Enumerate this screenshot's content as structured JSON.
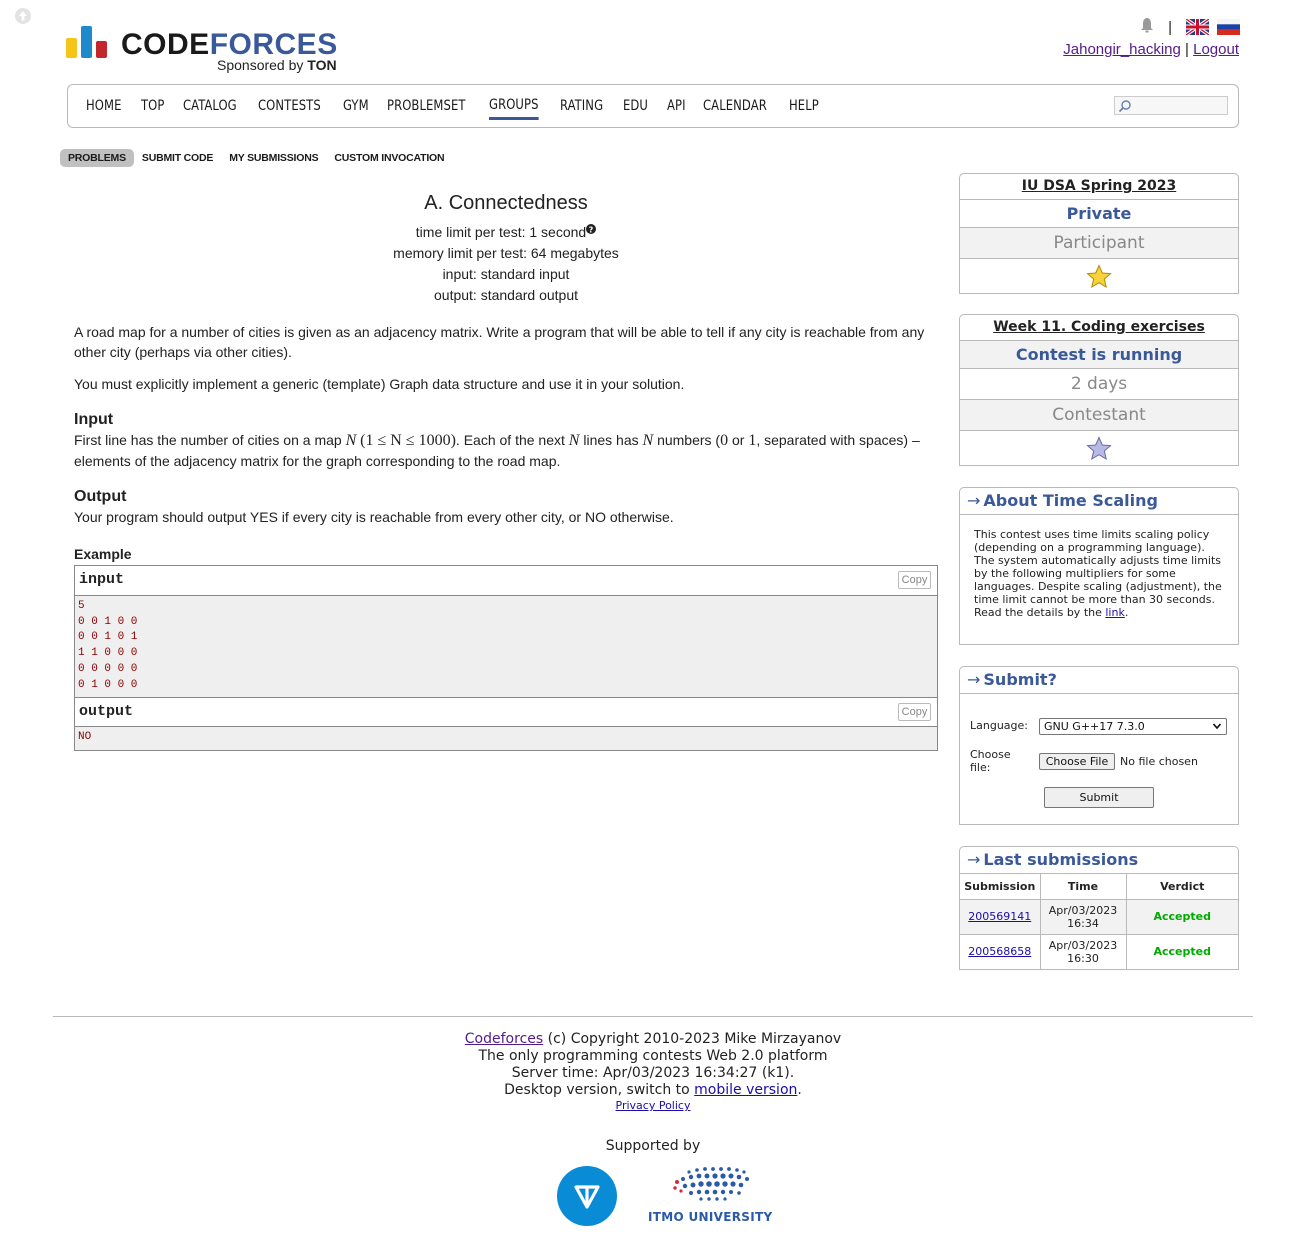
{
  "header": {
    "logo_text_a": "CODE",
    "logo_text_b": "FORCES",
    "logo_sponsor": "Sponsored by",
    "logo_sponsor_brand": "TON",
    "username": "Jahongir_hacking",
    "separator": "|",
    "logout": "Logout"
  },
  "menu": {
    "items": [
      "HOME",
      "TOP",
      "CATALOG",
      "CONTESTS",
      "GYM",
      "PROBLEMSET",
      "GROUPS",
      "RATING",
      "EDU",
      "API",
      "CALENDAR",
      "HELP"
    ],
    "active": "GROUPS"
  },
  "subnav": {
    "items": [
      "PROBLEMS",
      "SUBMIT CODE",
      "MY SUBMISSIONS",
      "CUSTOM INVOCATION"
    ],
    "active": "PROBLEMS"
  },
  "problem": {
    "title": "A. Connectedness",
    "time_limit": "time limit per test: 1 second",
    "memory_limit": "memory limit per test: 64 megabytes",
    "input_file": "input: standard input",
    "output_file": "output: standard output",
    "statement_p1": "A road map for a number of cities is given as an adjacency matrix. Write a program that will be able to tell if any city is reachable from any other city (perhaps via other cities).",
    "statement_p2": "You must explicitly implement a generic (template) Graph data structure and use it in your solution.",
    "input_title": "Input",
    "input_text_1": "First line has the number of cities on a map",
    "input_math_1": "N",
    "input_math_2": "(1 ≤ N ≤ 1000)",
    "input_text_2": ". Each of the next",
    "input_math_3": "N",
    "input_text_3": "lines has",
    "input_math_4": "N",
    "input_text_4": "numbers (",
    "input_math_5": "0",
    "input_text_5": "or",
    "input_math_6": "1",
    "input_text_6": ", separated with spaces) – elements of the adjacency matrix for the graph corresponding to the road map.",
    "output_title": "Output",
    "output_text": "Your program should output YES if every city is reachable from every other city, or NO otherwise.",
    "example_title": "Example",
    "example_input_label": "input",
    "example_output_label": "output",
    "copy_label": "Copy",
    "example_input": "5\n0 0 1 0 0\n0 0 1 0 1\n1 1 0 0 0\n0 0 0 0 0\n0 1 0 0 0",
    "example_output": "NO"
  },
  "sidebar": {
    "group_box": {
      "title": "IU DSA Spring 2023",
      "visibility": "Private",
      "role": "Participant"
    },
    "contest_box": {
      "title": "Week 11. Coding exercises",
      "status": "Contest is running",
      "remaining": "2 days",
      "role": "Contestant"
    },
    "scaling_box": {
      "arrow": "→",
      "title": "About Time Scaling",
      "text": "This contest uses time limits scaling policy (depending on a programming language). The system automatically adjusts time limits by the following multipliers for some languages. Despite scaling (adjustment), the time limit cannot be more than 30 seconds. Read the details by the",
      "link": "link",
      "end": "."
    },
    "submit_box": {
      "arrow": "→",
      "title": "Submit?",
      "language_label": "Language:",
      "language_value": "GNU G++17 7.3.0",
      "file_label": "Choose file:",
      "choose_file_button": "Choose File",
      "no_file": "No file chosen",
      "submit_button": "Submit"
    },
    "last_submissions": {
      "arrow": "→",
      "title": "Last submissions",
      "headers": [
        "Submission",
        "Time",
        "Verdict"
      ],
      "rows": [
        {
          "id": "200569141",
          "date": "Apr/03/2023",
          "time": "16:34",
          "verdict": "Accepted"
        },
        {
          "id": "200568658",
          "date": "Apr/03/2023",
          "time": "16:30",
          "verdict": "Accepted"
        }
      ]
    }
  },
  "footer": {
    "codeforces_link": "Codeforces",
    "copyright": "(c) Copyright 2010-2023 Mike Mirzayanov",
    "tagline": "The only programming contests Web 2.0 platform",
    "server_time": "Server time: Apr/03/2023 16:34:27 (k1).",
    "desktop_text": "Desktop version, switch to",
    "mobile_link": "mobile version",
    "desktop_end": ".",
    "privacy": "Privacy Policy",
    "supported_by": "Supported by",
    "itmo": "ITMO UNIVERSITY"
  },
  "colors": {
    "accent": "#3b5998",
    "accepted": "#00aa00",
    "sample_text": "#8b0000",
    "logo_yellow": "#f5c518",
    "logo_blue": "#1f8acb",
    "logo_red": "#c1272d"
  },
  "icons": [
    "scroll-top-icon",
    "notification-bell-icon",
    "flag-english-icon",
    "flag-russian-icon",
    "search-icon",
    "star-icon",
    "ton-logo",
    "itmo-logo"
  ]
}
